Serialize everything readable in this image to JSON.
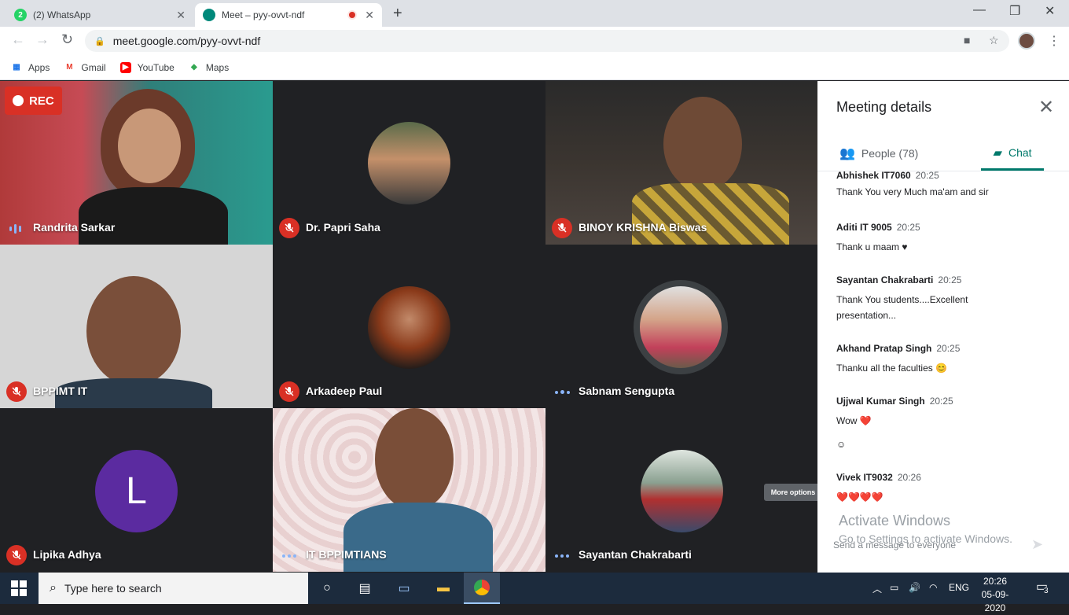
{
  "browser": {
    "tabs": [
      {
        "title": "(2) WhatsApp",
        "badge": "2"
      },
      {
        "title": "Meet – pyy-ovvt-ndf"
      }
    ],
    "url": "meet.google.com/pyy-ovvt-ndf",
    "bookmarks": [
      "Apps",
      "Gmail",
      "YouTube",
      "Maps"
    ]
  },
  "meeting": {
    "rec_label": "REC",
    "participants": [
      {
        "name": "Randrita Sarkar",
        "muted": false
      },
      {
        "name": "Dr. Papri Saha",
        "muted": true
      },
      {
        "name": "BINOY KRISHNA Biswas",
        "muted": true
      },
      {
        "name": "BPPIMT IT",
        "muted": true
      },
      {
        "name": "Arkadeep Paul",
        "muted": true
      },
      {
        "name": "Sabnam Sengupta",
        "muted": false
      },
      {
        "name": "Lipika Adhya",
        "muted": true,
        "initial": "L"
      },
      {
        "name": "IT BPPIMTIANS",
        "muted": false
      },
      {
        "name": "Sayantan Chakrabarti",
        "muted": false
      }
    ],
    "tooltip": "More options"
  },
  "panel": {
    "title": "Meeting details",
    "tabs": {
      "people": "People (78)",
      "chat": "Chat"
    },
    "messages": [
      {
        "sender": "Abhishek IT7060",
        "time": "20:25",
        "text": "Thank  You  very Much  ma'am and sir"
      },
      {
        "sender": "Aditi IT 9005",
        "time": "20:25",
        "text": "Thank u maam ♥"
      },
      {
        "sender": "Sayantan Chakrabarti",
        "time": "20:25",
        "text": "Thank You students....Excellent presentation..."
      },
      {
        "sender": "Akhand Pratap Singh",
        "time": "20:25",
        "text": "Thanku all the faculties 😊"
      },
      {
        "sender": "Ujjwal Kumar Singh",
        "time": "20:25",
        "text": "Wow ❤️",
        "extra": "☺"
      },
      {
        "sender": "Vivek IT9032",
        "time": "20:26",
        "text": "❤️❤️❤️❤️"
      }
    ],
    "activate_title": "Activate Windows",
    "activate_sub": "Go to Settings to activate Windows.",
    "send_placeholder": "Send a message to everyone"
  },
  "taskbar": {
    "search_placeholder": "Type here to search",
    "lang": "ENG",
    "time": "20:26",
    "date": "05-09-2020",
    "notification_count": "3"
  }
}
